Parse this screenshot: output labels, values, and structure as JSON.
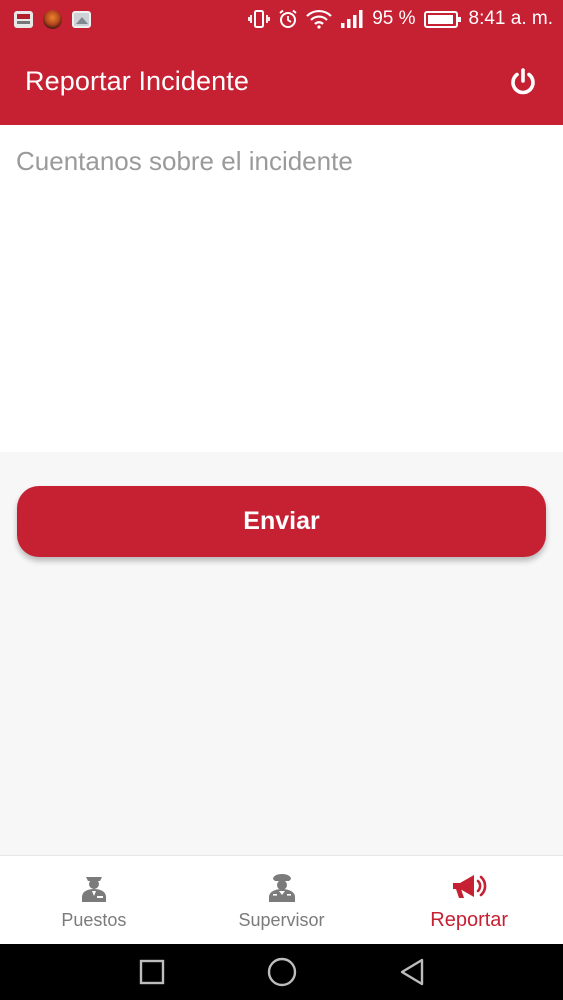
{
  "status_bar": {
    "battery_percent": "95 %",
    "time": "8:41 a. m."
  },
  "app_bar": {
    "title": "Reportar Incidente",
    "power_icon": "power-icon"
  },
  "incident_form": {
    "placeholder": "Cuentanos sobre el incidente",
    "value": "",
    "submit_label": "Enviar"
  },
  "bottom_nav": {
    "items": [
      {
        "label": "Puestos",
        "icon": "security-guard-icon",
        "active": false
      },
      {
        "label": "Supervisor",
        "icon": "supervisor-icon",
        "active": false
      },
      {
        "label": "Reportar",
        "icon": "megaphone-icon",
        "active": true
      }
    ]
  },
  "colors": {
    "primary": "#c62033",
    "inactive": "#7b7b7b",
    "background": "#f7f7f7"
  }
}
